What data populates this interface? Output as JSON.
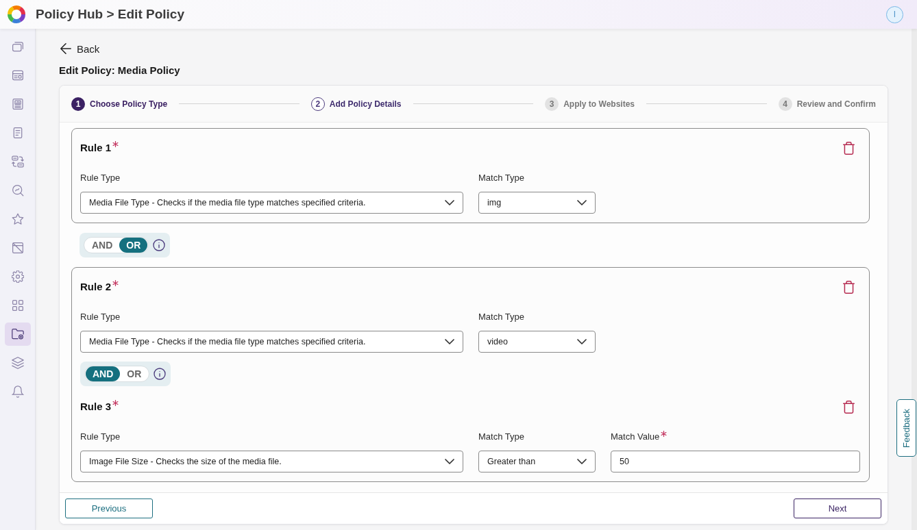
{
  "header": {
    "title": "Policy Hub > Edit Policy",
    "avatar_initial": "I"
  },
  "sidebar": {
    "items": [
      {
        "selected": false
      },
      {
        "selected": false
      },
      {
        "selected": false
      },
      {
        "selected": false
      },
      {
        "selected": false
      },
      {
        "selected": false
      },
      {
        "selected": false
      },
      {
        "selected": false
      },
      {
        "selected": false
      },
      {
        "selected": false
      },
      {
        "selected": true
      },
      {
        "selected": false
      },
      {
        "selected": false
      }
    ]
  },
  "back_link": {
    "label": "Back"
  },
  "page_title": "Edit Policy: Media Policy",
  "stepper": {
    "steps": [
      {
        "number": "1",
        "label": "Choose Policy Type",
        "completed": true,
        "selected": false
      },
      {
        "number": "2",
        "label": "Add Policy Details",
        "completed": false,
        "selected": true
      },
      {
        "number": "3",
        "label": "Apply to Websites",
        "completed": false,
        "selected": false
      },
      {
        "number": "4",
        "label": "Review and Confirm",
        "completed": false,
        "selected": false
      }
    ]
  },
  "rule_sections": [
    {
      "kind": "group",
      "items": [
        {
          "kind": "rule",
          "title": "Rule 1",
          "required": true,
          "fields": [
            {
              "kind": "select",
              "label": "Rule Type",
              "required": false,
              "value": "Media File Type - Checks if the media file type matches specified criteria."
            },
            {
              "kind": "select",
              "label": "Match Type",
              "required": false,
              "value": "img"
            }
          ]
        }
      ]
    },
    {
      "kind": "connector",
      "options": [
        {
          "label": "AND",
          "selected": false
        },
        {
          "label": "OR",
          "selected": true
        }
      ]
    },
    {
      "kind": "group",
      "items": [
        {
          "kind": "rule",
          "title": "Rule 2",
          "required": true,
          "fields": [
            {
              "kind": "select",
              "label": "Rule Type",
              "required": false,
              "value": "Media File Type - Checks if the media file type matches specified criteria."
            },
            {
              "kind": "select",
              "label": "Match Type",
              "required": false,
              "value": "video"
            }
          ]
        },
        {
          "kind": "connector",
          "options": [
            {
              "label": "AND",
              "selected": true
            },
            {
              "label": "OR",
              "selected": false
            }
          ]
        },
        {
          "kind": "rule",
          "title": "Rule 3",
          "required": true,
          "fields": [
            {
              "kind": "select",
              "label": "Rule Type",
              "required": false,
              "value": "Image File Size - Checks the size of the media file."
            },
            {
              "kind": "select",
              "label": "Match Type",
              "required": false,
              "value": "Greater than"
            },
            {
              "kind": "text",
              "label": "Match Value",
              "required": true,
              "value": "50"
            }
          ]
        }
      ]
    }
  ],
  "footer": {
    "buttons": [
      {
        "label": "Previous",
        "kind": "secondary"
      },
      {
        "label": "Next",
        "kind": "primary"
      }
    ]
  },
  "feedback_tab": {
    "label": "Feedback"
  }
}
